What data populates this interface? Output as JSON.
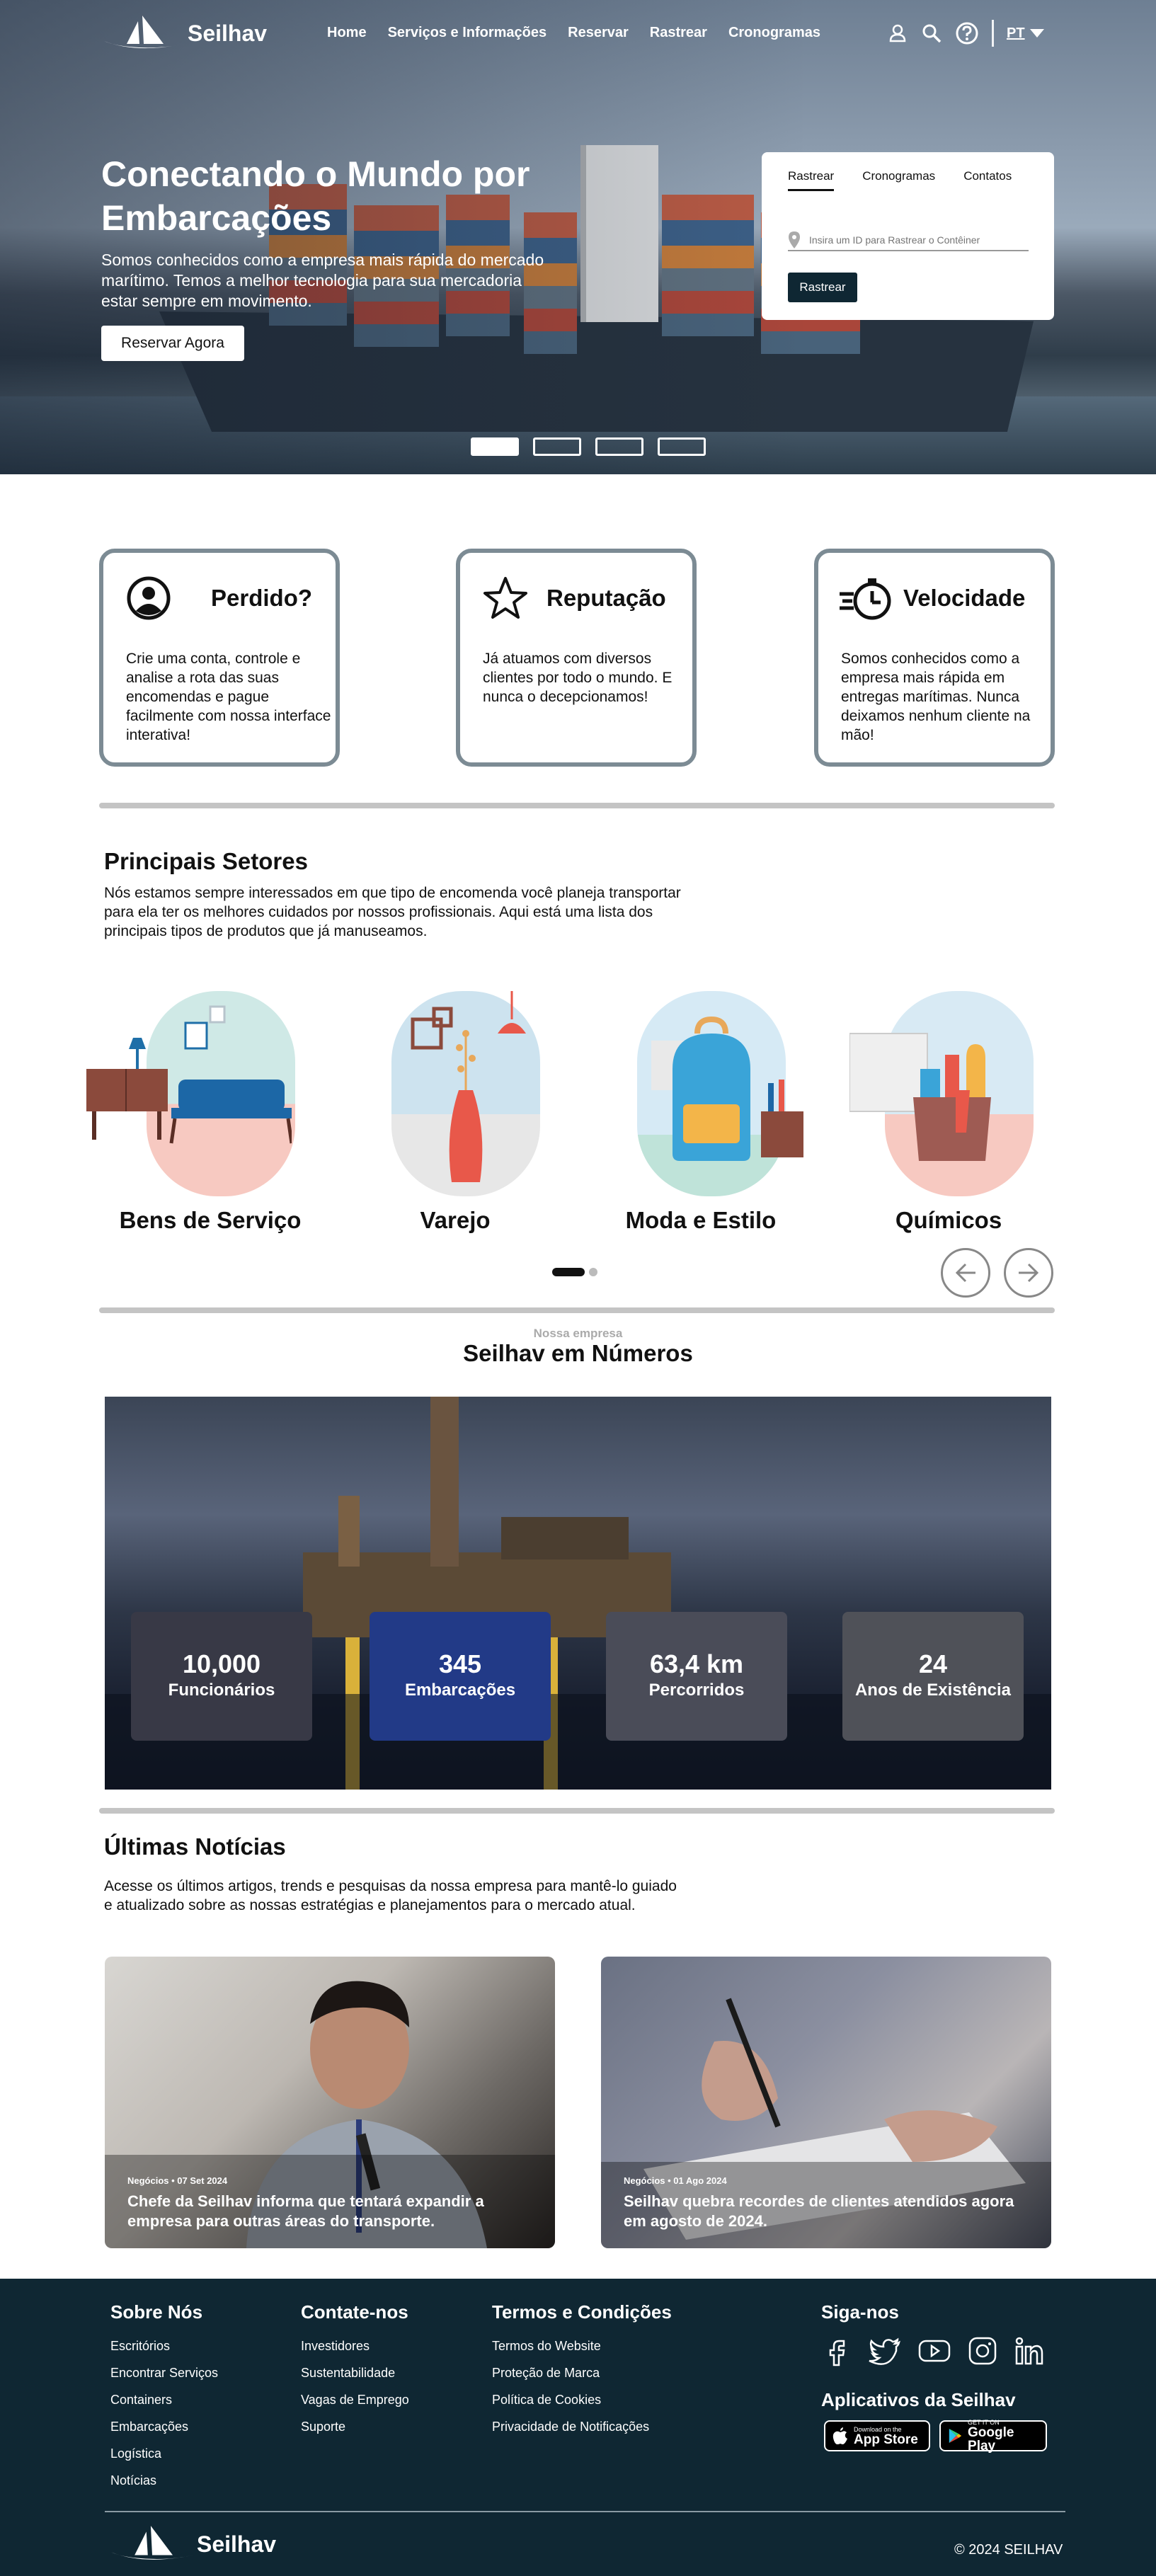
{
  "brand": {
    "name": "Seilhav"
  },
  "nav": {
    "links": [
      "Home",
      "Serviços e Informações",
      "Reservar",
      "Rastrear",
      "Cronogramas"
    ],
    "lang": "PT"
  },
  "hero": {
    "title": "Conectando o Mundo por Embarcações",
    "subtitle": "Somos conhecidos como a empresa mais rápida do mercado marítimo. Temos a melhor tecnologia para sua mercadoria estar sempre em movimento.",
    "cta": "Reservar Agora"
  },
  "track": {
    "tabs": [
      "Rastrear",
      "Cronogramas",
      "Contatos"
    ],
    "placeholder": "Insira um ID para Rastrear o Contêiner",
    "button": "Rastrear"
  },
  "features": [
    {
      "title": "Perdido?",
      "text": "Crie uma conta, controle e analise a rota das suas encomendas e pague facilmente com nossa interface interativa!",
      "icon": "user-icon"
    },
    {
      "title": "Reputação",
      "text": "Já atuamos com diversos clientes por todo o mundo. E nunca o decepcionamos!",
      "icon": "star-icon"
    },
    {
      "title": "Velocidade",
      "text": "Somos conhecidos como a empresa mais rápida em entregas marítimas. Nunca deixamos nenhum cliente na mão!",
      "icon": "fast-timer-icon"
    }
  ],
  "sectors": {
    "title": "Principais Setores",
    "text": "Nós estamos sempre interessados em que tipo de encomenda você planeja transportar para ela ter os melhores cuidados por nossos profissionais. Aqui está uma lista dos principais tipos de produtos que já manuseamos.",
    "items": [
      "Bens de Serviço",
      "Varejo",
      "Moda e Estilo",
      "Químicos"
    ]
  },
  "numbers": {
    "kicker": "Nossa empresa",
    "title": "Seilhav em Números",
    "stats": [
      {
        "value": "10,000",
        "label": "Funcionários",
        "color": "#383946"
      },
      {
        "value": "345",
        "label": "Embarcações",
        "color": "#223a87"
      },
      {
        "value": "63,4 km",
        "label": "Percorridos",
        "color": "#4a4c58"
      },
      {
        "value": "24",
        "label": "Anos de Existência",
        "color": "#4f5158"
      }
    ]
  },
  "news": {
    "title": "Últimas Notícias",
    "text": "Acesse os últimos artigos, trends e pesquisas da nossa empresa para mantê-lo guiado e atualizado sobre as nossas estratégias e planejamentos para o mercado atual.",
    "items": [
      {
        "meta": "Negócios • 07 Set 2024",
        "headline": "Chefe da Seilhav informa que tentará expandir a empresa para outras áreas do transporte."
      },
      {
        "meta": "Negócios • 01 Ago 2024",
        "headline": "Seilhav quebra recordes de clientes atendidos agora em agosto de 2024."
      }
    ]
  },
  "footer": {
    "about": {
      "title": "Sobre Nós",
      "items": [
        "Escritórios",
        "Encontrar Serviços",
        "Containers",
        "Embarcações",
        "Logística",
        "Notícias"
      ]
    },
    "contact": {
      "title": "Contate-nos",
      "items": [
        "Investidores",
        "Sustentabilidade",
        "Vagas de Emprego",
        "Suporte"
      ]
    },
    "terms": {
      "title": "Termos e Condições",
      "items": [
        "Termos do Website",
        "Proteção de Marca",
        "Política de Cookies",
        "Privacidade de Notificações"
      ]
    },
    "follow": {
      "title": "Siga-nos",
      "icons": [
        "facebook-icon",
        "twitter-icon",
        "youtube-icon",
        "instagram-icon",
        "linkedin-icon"
      ]
    },
    "apps": {
      "title": "Aplicativos da Seilhav",
      "appstore_small": "Download on the",
      "appstore": "App Store",
      "play_small": "GET IT ON",
      "play": "Google Play"
    },
    "copyright": "© 2024 SEILHAV"
  }
}
